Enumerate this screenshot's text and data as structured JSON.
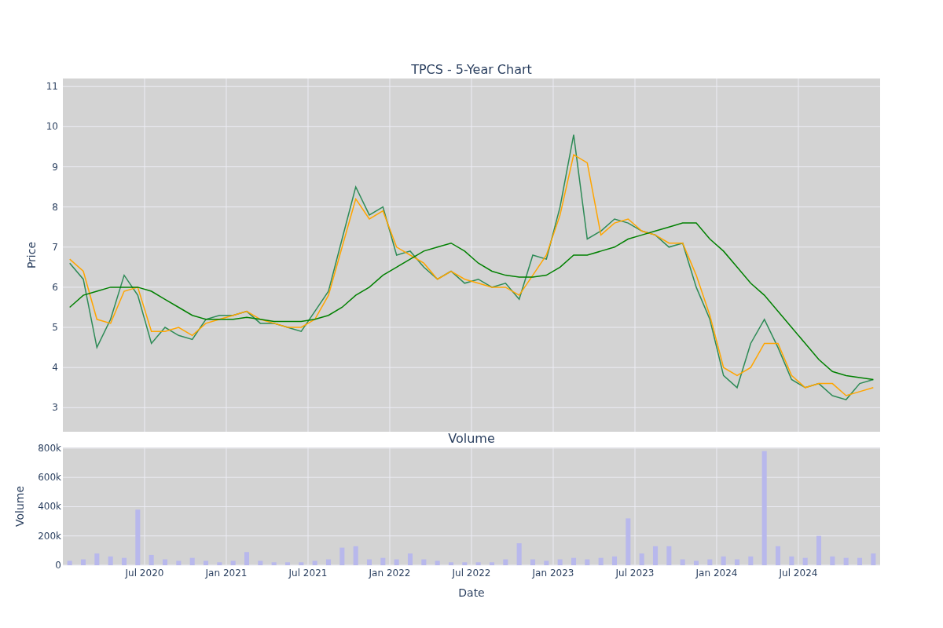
{
  "price_chart": {
    "chart_data": {
      "type": "line",
      "title": "TPCS - 5-Year Chart",
      "ylabel": "Price",
      "categories": [
        null,
        null,
        null,
        null,
        null,
        null,
        null,
        null,
        null,
        null,
        null,
        null,
        null,
        null,
        null,
        null,
        null,
        null,
        null,
        null,
        null,
        null,
        null,
        null,
        null,
        null,
        null,
        null,
        null,
        null,
        null,
        null,
        null,
        null,
        null,
        null,
        null,
        null,
        null,
        null,
        null,
        null,
        null,
        null,
        null,
        null,
        null,
        null,
        null,
        null,
        null,
        null,
        null,
        null,
        null,
        null,
        null,
        null,
        null,
        null
      ],
      "ylim": [
        2.4,
        11.2
      ],
      "grid": true,
      "yticks": [
        3,
        4,
        5,
        6,
        7,
        8,
        9,
        10,
        11
      ],
      "series": [
        {
          "color": "#2e8b57",
          "values": [
            6.6,
            6.2,
            4.5,
            5.2,
            6.3,
            5.8,
            4.6,
            5.0,
            4.8,
            4.7,
            5.2,
            5.3,
            5.3,
            5.4,
            5.1,
            5.1,
            5.0,
            4.9,
            5.4,
            5.9,
            7.2,
            8.5,
            7.8,
            8.0,
            6.8,
            6.9,
            6.5,
            6.2,
            6.4,
            6.1,
            6.2,
            6.0,
            6.1,
            5.7,
            6.8,
            6.7,
            8.0,
            9.8,
            7.2,
            7.4,
            7.7,
            7.6,
            7.4,
            7.3,
            7.0,
            7.1,
            6.0,
            5.2,
            3.8,
            3.5,
            4.6,
            5.2,
            4.5,
            3.7,
            3.5,
            3.6,
            3.3,
            3.2,
            3.6,
            3.7
          ]
        },
        {
          "color": "#ffa500",
          "values": [
            6.7,
            6.4,
            5.2,
            5.1,
            5.9,
            6.0,
            4.9,
            4.9,
            5.0,
            4.8,
            5.1,
            5.2,
            5.3,
            5.4,
            5.2,
            5.1,
            5.0,
            5.0,
            5.2,
            5.8,
            7.0,
            8.2,
            7.7,
            7.9,
            7.0,
            6.8,
            6.6,
            6.2,
            6.4,
            6.2,
            6.1,
            6.0,
            6.0,
            5.8,
            6.3,
            6.8,
            7.8,
            9.3,
            9.1,
            7.3,
            7.6,
            7.7,
            7.4,
            7.3,
            7.1,
            7.1,
            6.3,
            5.3,
            4.0,
            3.8,
            4.0,
            4.6,
            4.6,
            3.8,
            3.5,
            3.6,
            3.6,
            3.3,
            3.4,
            3.5
          ]
        },
        {
          "color": "#008000",
          "values": [
            5.5,
            5.8,
            5.9,
            6.0,
            6.0,
            6.0,
            5.9,
            5.7,
            5.5,
            5.3,
            5.2,
            5.2,
            5.2,
            5.25,
            5.2,
            5.15,
            5.15,
            5.15,
            5.2,
            5.3,
            5.5,
            5.8,
            6.0,
            6.3,
            6.5,
            6.7,
            6.9,
            7.0,
            7.1,
            6.9,
            6.6,
            6.4,
            6.3,
            6.25,
            6.25,
            6.3,
            6.5,
            6.8,
            6.8,
            6.9,
            7.0,
            7.2,
            7.3,
            7.4,
            7.5,
            7.6,
            7.6,
            7.2,
            6.9,
            6.5,
            6.1,
            5.8,
            5.4,
            5.0,
            4.6,
            4.2,
            3.9,
            3.8,
            3.75,
            3.7
          ]
        }
      ]
    }
  },
  "volume_chart": {
    "chart_data": {
      "type": "bar",
      "title": "Volume",
      "xlabel": "Date",
      "ylabel": "Volume",
      "categories": [
        null,
        null,
        null,
        null,
        null,
        null,
        "Jul 2020",
        null,
        null,
        null,
        null,
        null,
        "Jan 2021",
        null,
        null,
        null,
        null,
        null,
        "Jul 2021",
        null,
        null,
        null,
        null,
        null,
        "Jan 2022",
        null,
        null,
        null,
        null,
        null,
        "Jul 2022",
        null,
        null,
        null,
        null,
        null,
        "Jan 2023",
        null,
        null,
        null,
        null,
        null,
        "Jul 2023",
        null,
        null,
        null,
        null,
        null,
        "Jan 2024",
        null,
        null,
        null,
        null,
        null,
        "Jul 2024",
        null,
        null,
        null,
        null,
        null
      ],
      "ylim": [
        0,
        805000
      ],
      "grid": true,
      "yticks": [
        {
          "value": 0,
          "label": "0"
        },
        {
          "value": 200000,
          "label": "200k"
        },
        {
          "value": 400000,
          "label": "400k"
        },
        {
          "value": 600000,
          "label": "600k"
        },
        {
          "value": 800000,
          "label": "800k"
        }
      ],
      "series": [
        {
          "color": "#b8b8ec",
          "values": [
            30000,
            40000,
            80000,
            60000,
            50000,
            380000,
            70000,
            40000,
            30000,
            50000,
            30000,
            20000,
            30000,
            90000,
            30000,
            20000,
            20000,
            20000,
            30000,
            40000,
            120000,
            130000,
            40000,
            50000,
            40000,
            80000,
            40000,
            30000,
            20000,
            20000,
            20000,
            20000,
            40000,
            150000,
            40000,
            30000,
            40000,
            50000,
            40000,
            50000,
            60000,
            320000,
            80000,
            130000,
            130000,
            40000,
            30000,
            40000,
            60000,
            40000,
            60000,
            780000,
            130000,
            60000,
            50000,
            200000,
            60000,
            50000,
            50000,
            80000
          ]
        }
      ]
    }
  }
}
